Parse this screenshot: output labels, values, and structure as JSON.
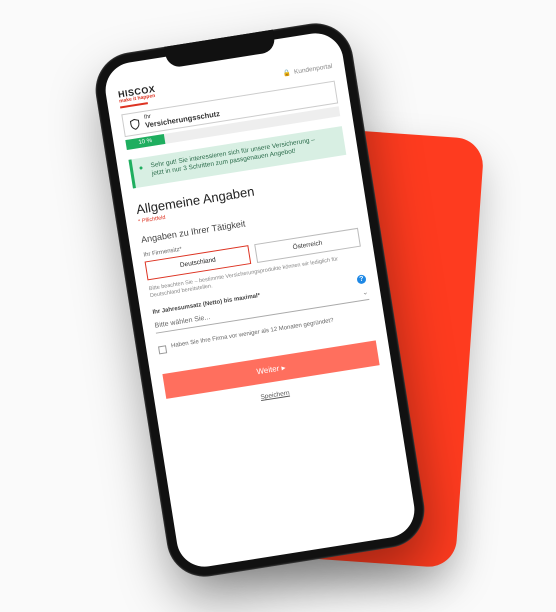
{
  "logo": {
    "name": "HISCOX",
    "tagline": "make it happen"
  },
  "topbar": {
    "portal_label": "Kundenportal"
  },
  "step": {
    "pre": "Ihr",
    "title": "Versicherungsschutz"
  },
  "progress": {
    "percent_label": "10 %",
    "percent_width": "18%"
  },
  "banner": {
    "line1": "Sehr gut! Sie interessieren sich für unsere Versicherung –",
    "line2": "jetzt in nur 3 Schritten zum passgenauen Angebot!"
  },
  "section": {
    "title": "Allgemeine Angaben",
    "required_note": "* Pflichtfeld",
    "subsection": "Angaben zu Ihrer Tätigkeit"
  },
  "country": {
    "label": "Ihr Firmensitz*",
    "opt1": "Deutschland",
    "opt2": "Österreich",
    "hint": "Bitte beachten Sie – bestimmte Versicherungsprodukte können wir lediglich für Deutschland bereitstellen."
  },
  "revenue": {
    "label": "Ihr Jahresumsatz (Netto) bis maximal*",
    "placeholder": "Bitte wählen Sie..."
  },
  "checkbox": {
    "text": "Haben Sie Ihre Firma vor weniger als 12 Monaten gegründet?"
  },
  "cta": {
    "label": "Weiter",
    "arrow": "▸"
  },
  "save": {
    "label": "Speichern"
  }
}
